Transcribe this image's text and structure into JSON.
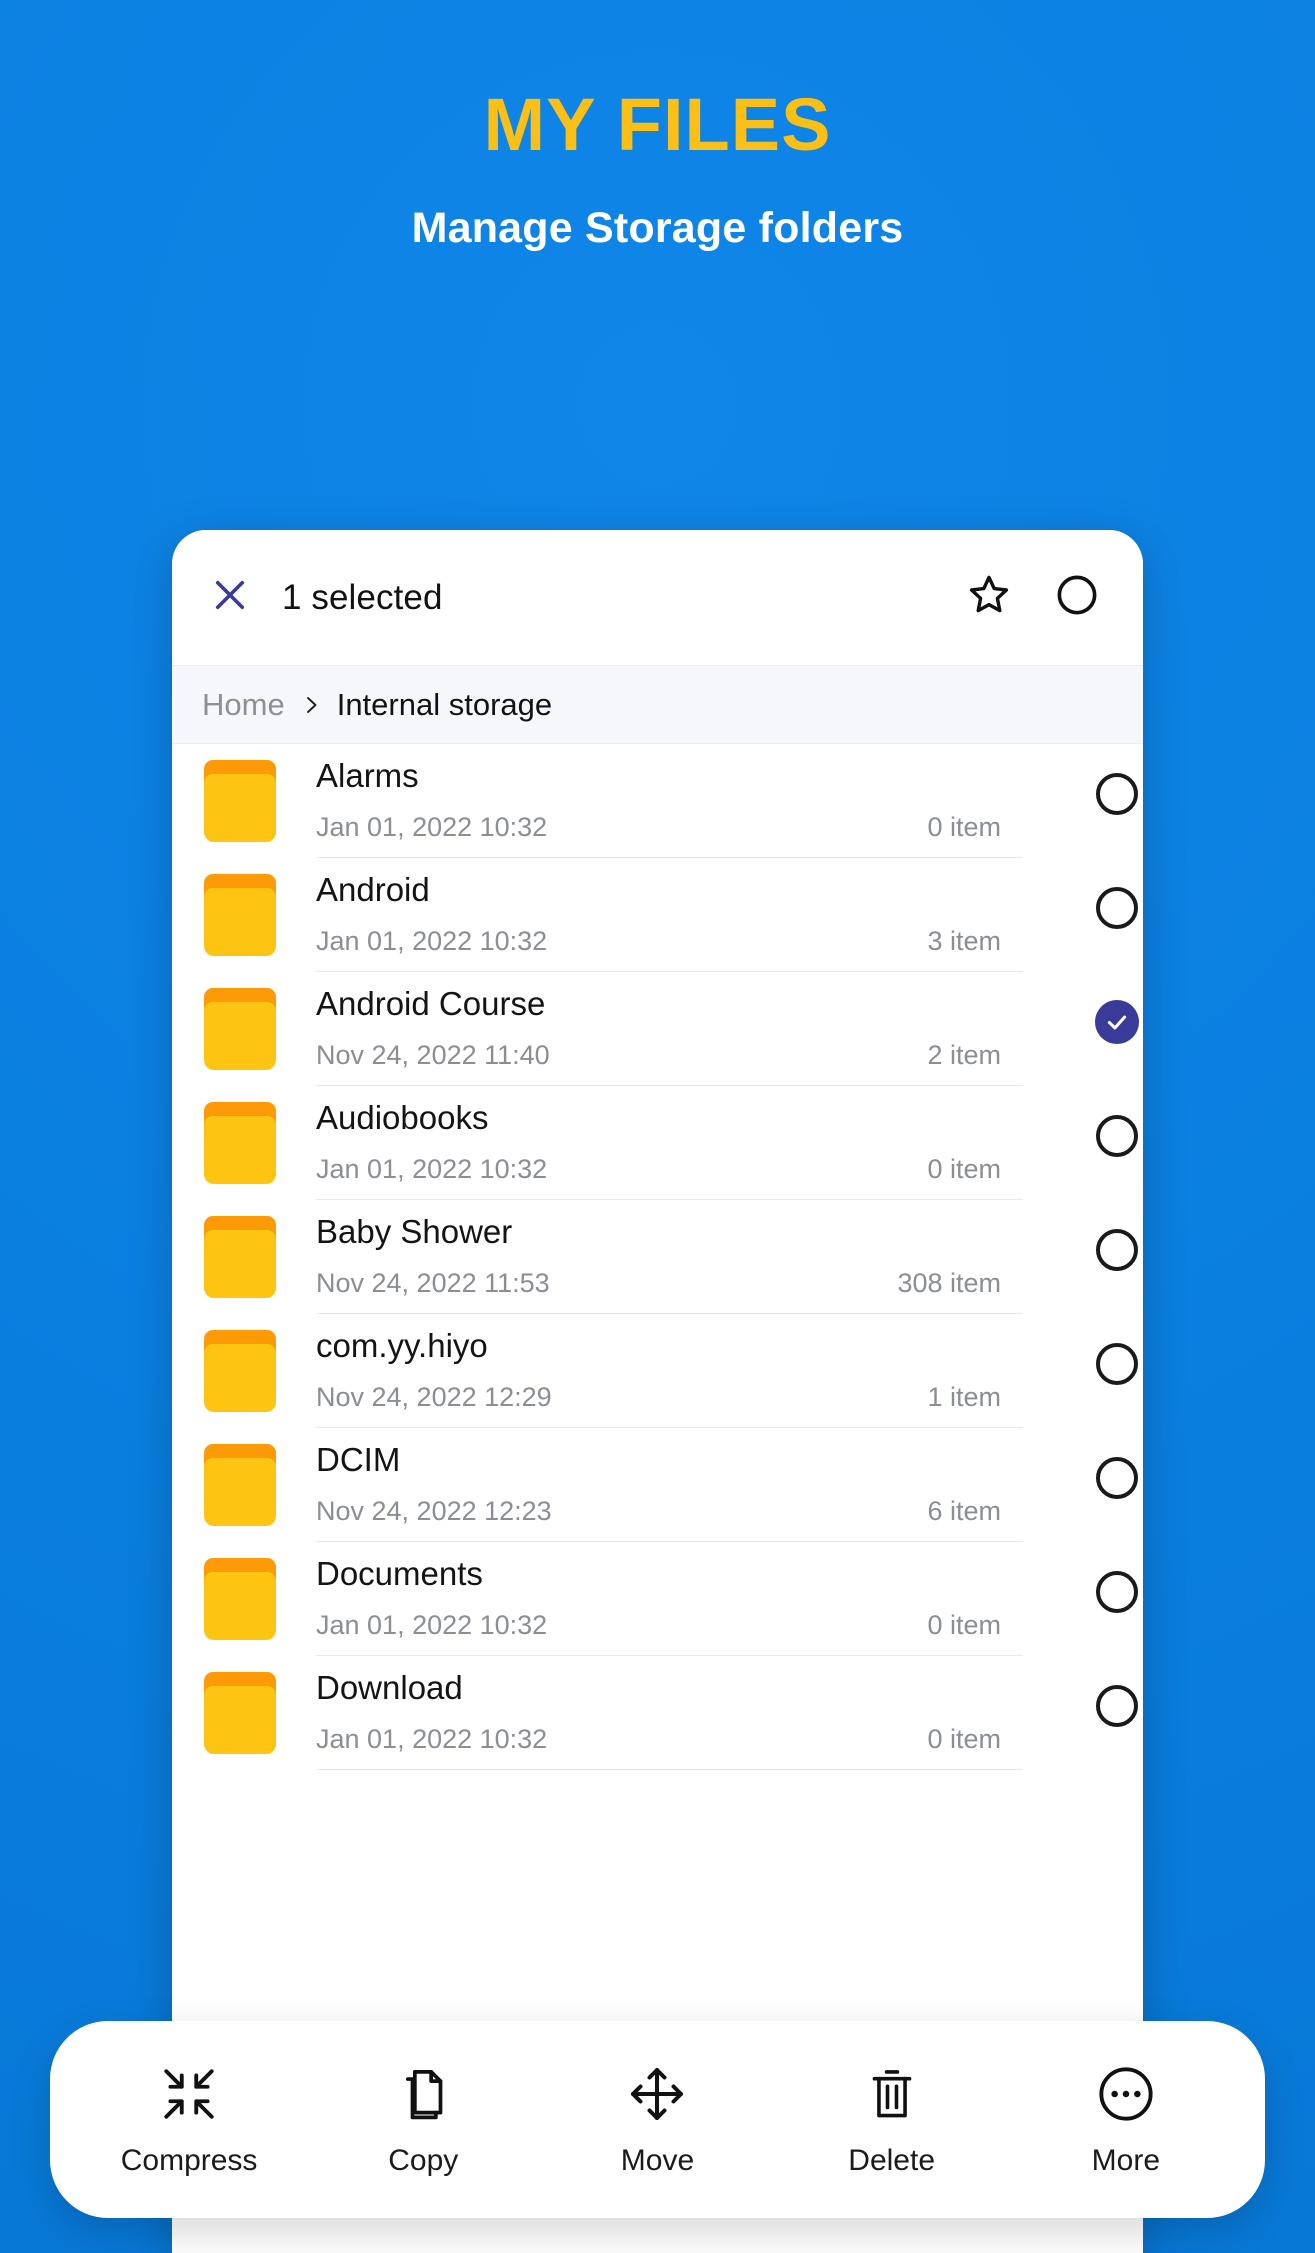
{
  "hero": {
    "title": "MY FILES",
    "subtitle": "Manage Storage folders",
    "title_color": "#FBBF16",
    "background_color": "#0A80E2"
  },
  "appbar": {
    "close_icon": "close-icon",
    "title": "1 selected",
    "star_icon": "star-outline-icon",
    "select_all_icon": "circle-unchecked-icon"
  },
  "breadcrumb": {
    "home": "Home",
    "separator": "chevron-right-icon",
    "current": "Internal storage"
  },
  "files": [
    {
      "name": "Alarms",
      "date": "Jan 01, 2022 10:32",
      "count": "0 item",
      "selected": false
    },
    {
      "name": "Android",
      "date": "Jan 01, 2022 10:32",
      "count": "3 item",
      "selected": false
    },
    {
      "name": "Android Course",
      "date": "Nov 24, 2022 11:40",
      "count": "2 item",
      "selected": true
    },
    {
      "name": "Audiobooks",
      "date": "Jan 01, 2022 10:32",
      "count": "0 item",
      "selected": false
    },
    {
      "name": "Baby Shower",
      "date": "Nov 24, 2022 11:53",
      "count": "308 item",
      "selected": false
    },
    {
      "name": "com.yy.hiyo",
      "date": "Nov 24, 2022 12:29",
      "count": "1 item",
      "selected": false
    },
    {
      "name": "DCIM",
      "date": "Nov 24, 2022 12:23",
      "count": "6 item",
      "selected": false
    },
    {
      "name": "Documents",
      "date": "Jan 01, 2022 10:32",
      "count": "0 item",
      "selected": false
    },
    {
      "name": "Download",
      "date": "Jan 01, 2022 10:32",
      "count": "0 item",
      "selected": false
    }
  ],
  "toolbar": [
    {
      "label": "Compress",
      "icon": "compress-icon"
    },
    {
      "label": "Copy",
      "icon": "copy-icon"
    },
    {
      "label": "Move",
      "icon": "move-icon"
    },
    {
      "label": "Delete",
      "icon": "trash-icon"
    },
    {
      "label": "More",
      "icon": "more-horizontal-icon"
    }
  ],
  "colors": {
    "selected_check": "#3A3B98",
    "folder_tab": "#FD9A07",
    "folder_body": "#FDC412",
    "breadcrumb_bg": "#F6F7FA"
  }
}
